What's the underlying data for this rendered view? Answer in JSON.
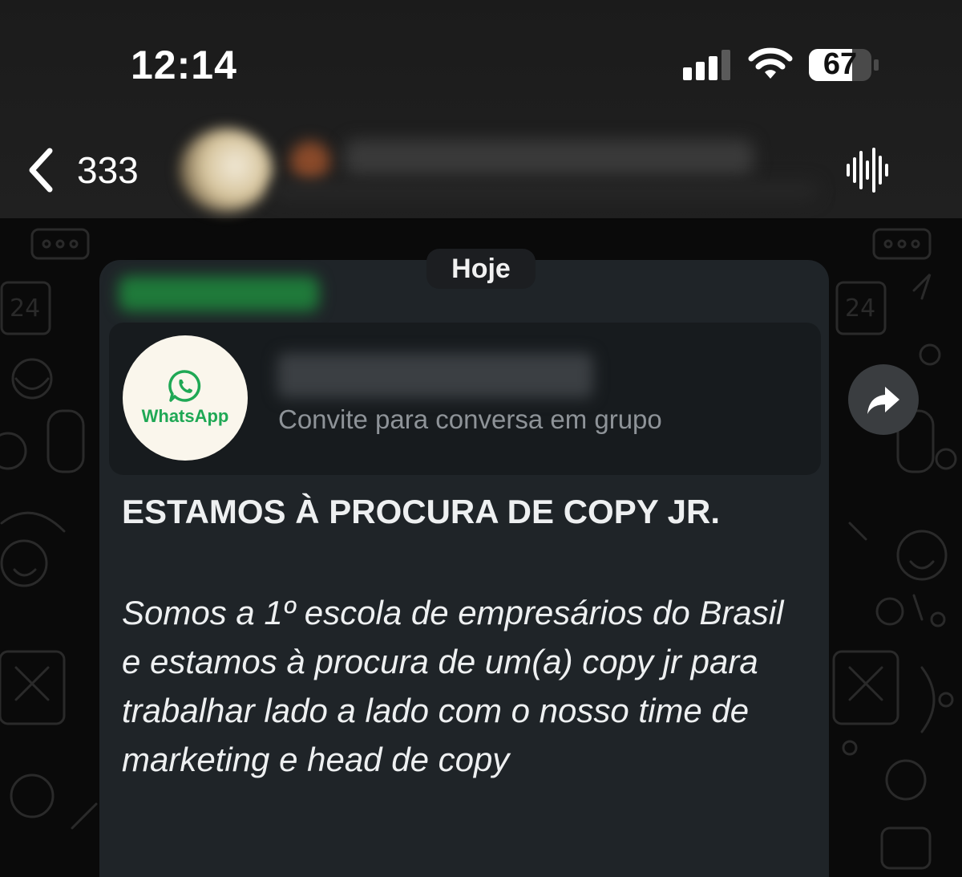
{
  "status_bar": {
    "time": "12:14",
    "battery": "67",
    "icons": [
      "signal-icon",
      "wifi-icon",
      "battery-icon"
    ]
  },
  "header": {
    "back_count": "333",
    "icons": [
      "chevron-left-icon",
      "voice-call-icon"
    ]
  },
  "chat": {
    "date_label": "Hoje",
    "invite_card": {
      "logo_text": "WhatsApp",
      "subtitle": "Convite para conversa em grupo"
    },
    "message": {
      "heading": "ESTAMOS À PROCURA DE COPY JR.",
      "body": "Somos a 1º escola de empresários do Brasil e estamos à procura de um(a) copy jr para trabalhar lado a lado com o nosso time de marketing e head de copy"
    }
  },
  "colors": {
    "whatsapp_green": "#1fa855",
    "bubble": "#1f2428"
  }
}
